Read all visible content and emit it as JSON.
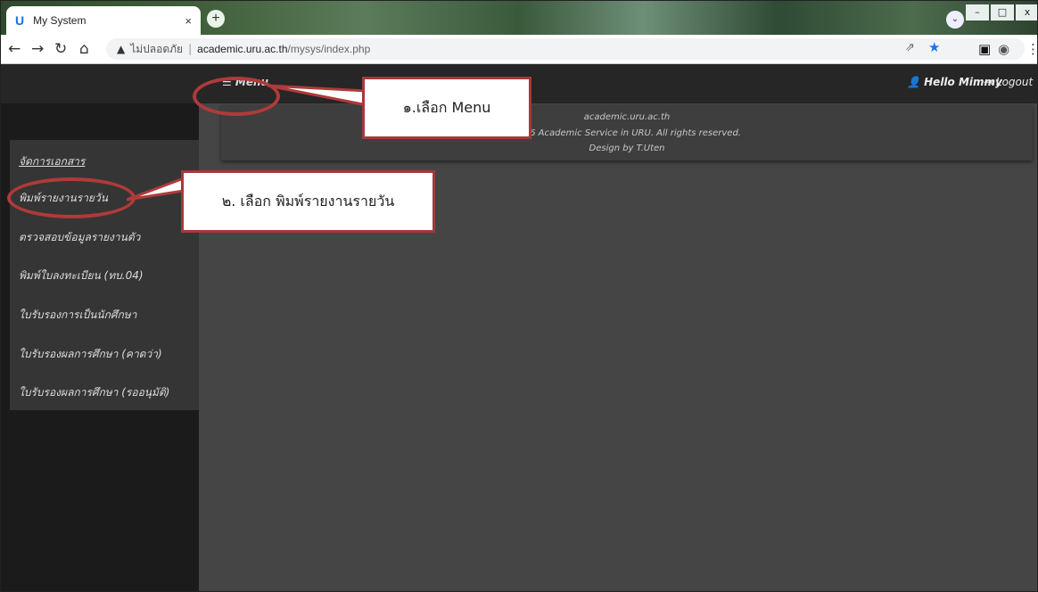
{
  "browser": {
    "tab_title": "My System",
    "tab_close": "×",
    "new_tab": "+",
    "insecure_label": "ไม่ปลอดภัย",
    "url_host": "academic.uru.ac.th",
    "url_path": "/mysys/index.php",
    "window_controls": [
      "–",
      "□",
      "x"
    ]
  },
  "header": {
    "menu_label": "☰ Menu",
    "user_greeting": "Hello Mimmy",
    "logout_label": "Logout"
  },
  "sidebar": {
    "items": [
      {
        "label": "จัดการเอกสาร"
      },
      {
        "label": "พิมพ์รายงานรายวัน"
      },
      {
        "label": "ตรวจสอบข้อมูลรายงานตัว"
      },
      {
        "label": "พิมพ์ใบลงทะเบียน (ทบ.04)"
      },
      {
        "label": "ใบรับรองการเป็นนักศึกษา"
      },
      {
        "label": "ใบรับรองผลการศึกษา (คาดว่า)"
      },
      {
        "label": "ใบรับรองผลการศึกษา (รออนุมัติ)"
      }
    ]
  },
  "footer": {
    "site": "academic.uru.ac.th",
    "copyright": "2016 Academic Service in URU. All rights reserved.",
    "credit": "Design by T.Uten"
  },
  "annotations": {
    "callout1": "๑.เลือก  Menu",
    "callout2": "๒. เลือก พิมพ์รายงานรายวัน"
  },
  "colors": {
    "annotation_red": "#b03a3a",
    "header_bg": "#262626",
    "content_bg": "#454545"
  }
}
